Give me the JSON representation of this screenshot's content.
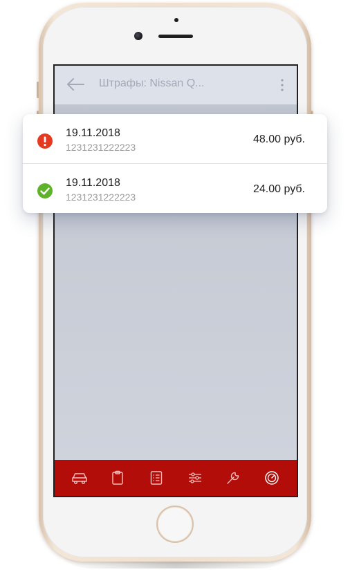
{
  "appbar": {
    "title": "Штрафы: Nissan Q..."
  },
  "fines": [
    {
      "date": "19.11.2018",
      "id": "1231231222223",
      "amount": "48.00 руб.",
      "status": "unpaid",
      "status_icon": "exclamation-circle-icon",
      "status_color": "#e53920"
    },
    {
      "date": "19.11.2018",
      "id": "1231231222223",
      "amount": "24.00 руб.",
      "status": "paid",
      "status_icon": "check-circle-icon",
      "status_color": "#5fb32b"
    }
  ],
  "tabbar": {
    "items": [
      {
        "icon": "car-icon"
      },
      {
        "icon": "clipboard-icon"
      },
      {
        "icon": "list-icon"
      },
      {
        "icon": "sliders-icon"
      },
      {
        "icon": "wrench-icon"
      },
      {
        "icon": "speedometer-icon",
        "active": true
      }
    ]
  },
  "colors": {
    "tabbar": "#b30d0a",
    "appbar": "#dde1ea",
    "screen": "#c9ced8",
    "phone_gold": "#efe0cf"
  }
}
